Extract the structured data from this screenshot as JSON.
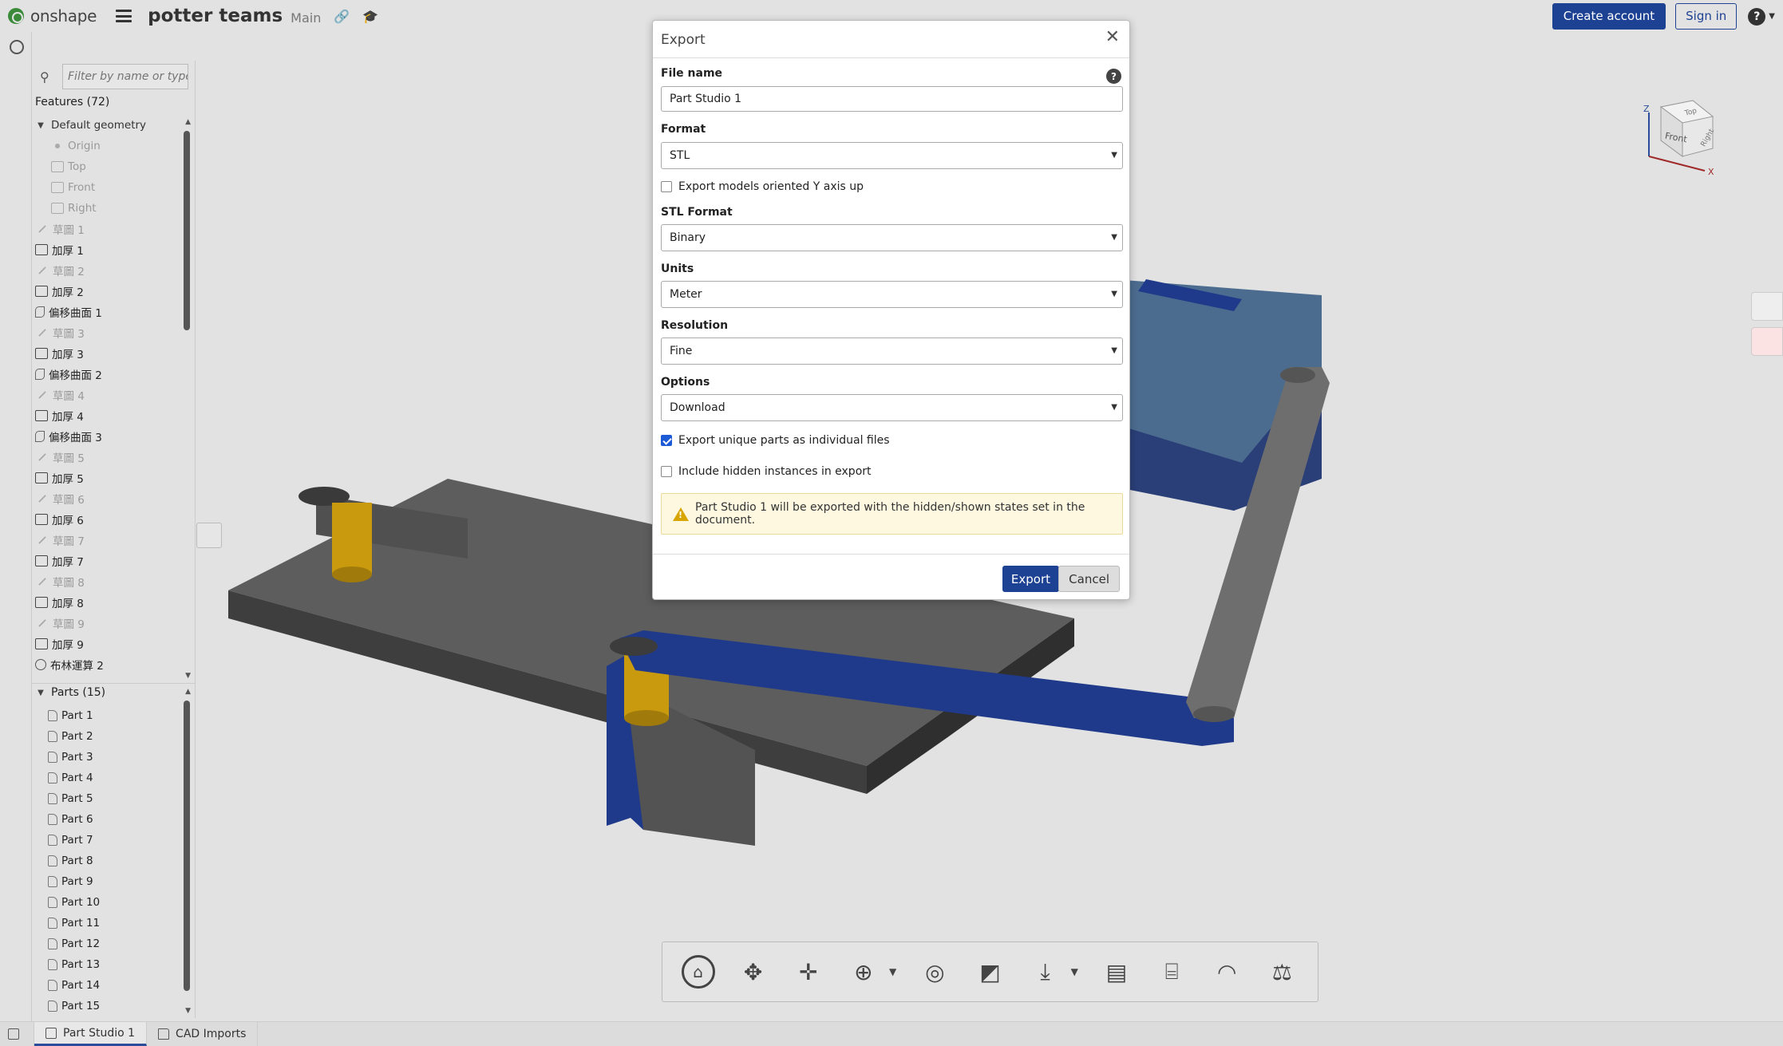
{
  "header": {
    "brand": "onshape",
    "doc_title": "potter teams",
    "branch": "Main",
    "create_account": "Create account",
    "sign_in": "Sign in",
    "help": "?"
  },
  "feature_panel": {
    "filter_placeholder": "Filter by name or type",
    "features_header": "Features (72)",
    "features": [
      {
        "label": "Default geometry",
        "icon": "chevron-down",
        "type": "group"
      },
      {
        "label": "Origin",
        "icon": "origin-icon",
        "type": "dim"
      },
      {
        "label": "Top",
        "icon": "plane-icon",
        "type": "dim"
      },
      {
        "label": "Front",
        "icon": "plane-icon",
        "type": "dim"
      },
      {
        "label": "Right",
        "icon": "plane-icon",
        "type": "dim"
      },
      {
        "label": "草圖 1",
        "icon": "sketch-icon",
        "type": "dim"
      },
      {
        "label": "加厚 1",
        "icon": "extrude-icon",
        "type": "normal"
      },
      {
        "label": "草圖 2",
        "icon": "sketch-icon",
        "type": "dim"
      },
      {
        "label": "加厚 2",
        "icon": "extrude-icon",
        "type": "normal"
      },
      {
        "label": "偏移曲面 1",
        "icon": "surface-icon",
        "type": "normal"
      },
      {
        "label": "草圖 3",
        "icon": "sketch-icon",
        "type": "dim"
      },
      {
        "label": "加厚 3",
        "icon": "extrude-icon",
        "type": "normal"
      },
      {
        "label": "偏移曲面 2",
        "icon": "surface-icon",
        "type": "normal"
      },
      {
        "label": "草圖 4",
        "icon": "sketch-icon",
        "type": "dim"
      },
      {
        "label": "加厚 4",
        "icon": "extrude-icon",
        "type": "normal"
      },
      {
        "label": "偏移曲面 3",
        "icon": "surface-icon",
        "type": "normal"
      },
      {
        "label": "草圖 5",
        "icon": "sketch-icon",
        "type": "dim"
      },
      {
        "label": "加厚 5",
        "icon": "extrude-icon",
        "type": "normal"
      },
      {
        "label": "草圖 6",
        "icon": "sketch-icon",
        "type": "dim"
      },
      {
        "label": "加厚 6",
        "icon": "extrude-icon",
        "type": "normal"
      },
      {
        "label": "草圖 7",
        "icon": "sketch-icon",
        "type": "dim"
      },
      {
        "label": "加厚 7",
        "icon": "extrude-icon",
        "type": "normal"
      },
      {
        "label": "草圖 8",
        "icon": "sketch-icon",
        "type": "dim"
      },
      {
        "label": "加厚 8",
        "icon": "extrude-icon",
        "type": "normal"
      },
      {
        "label": "草圖 9",
        "icon": "sketch-icon",
        "type": "dim"
      },
      {
        "label": "加厚 9",
        "icon": "extrude-icon",
        "type": "normal"
      },
      {
        "label": "布林運算 2",
        "icon": "boolean-icon",
        "type": "normal"
      }
    ],
    "parts_header": "Parts (15)",
    "parts": [
      "Part 1",
      "Part 2",
      "Part 3",
      "Part 4",
      "Part 5",
      "Part 6",
      "Part 7",
      "Part 8",
      "Part 9",
      "Part 10",
      "Part 11",
      "Part 12",
      "Part 13",
      "Part 14",
      "Part 15"
    ]
  },
  "viewcube": {
    "front": "Front",
    "top": "Top",
    "right": "Right",
    "axis_z": "Z",
    "axis_x": "X"
  },
  "bottom_tabs": {
    "part_studio": "Part Studio 1",
    "cad_imports": "CAD Imports"
  },
  "view_tools": [
    "home-icon",
    "view-rotate-icon",
    "pan-icon",
    "zoom-icon",
    "section-view-icon",
    "display-mode-icon",
    "export-download-icon",
    "print-icon",
    "measure-tape-icon",
    "protractor-icon",
    "mass-properties-icon"
  ],
  "export_dialog": {
    "title": "Export",
    "file_name_label": "File name",
    "file_name_value": "Part Studio 1",
    "format_label": "Format",
    "format_value": "STL",
    "y_axis_up_label": "Export models oriented Y axis up",
    "y_axis_up_checked": false,
    "stl_format_label": "STL Format",
    "stl_format_value": "Binary",
    "units_label": "Units",
    "units_value": "Meter",
    "resolution_label": "Resolution",
    "resolution_value": "Fine",
    "options_label": "Options",
    "options_value": "Download",
    "unique_parts_label": "Export unique parts as individual files",
    "unique_parts_checked": true,
    "hidden_instances_label": "Include hidden instances in export",
    "hidden_instances_checked": false,
    "warning": "Part Studio 1 will be exported with the hidden/shown states set in the document.",
    "export_button": "Export",
    "cancel_button": "Cancel"
  },
  "colors": {
    "accent": "#1d4193",
    "model_gray": "#5a5a5a",
    "model_blue": "#1f3a8a",
    "model_yellow": "#c99a0e",
    "warning_bg": "#fdf8df"
  }
}
